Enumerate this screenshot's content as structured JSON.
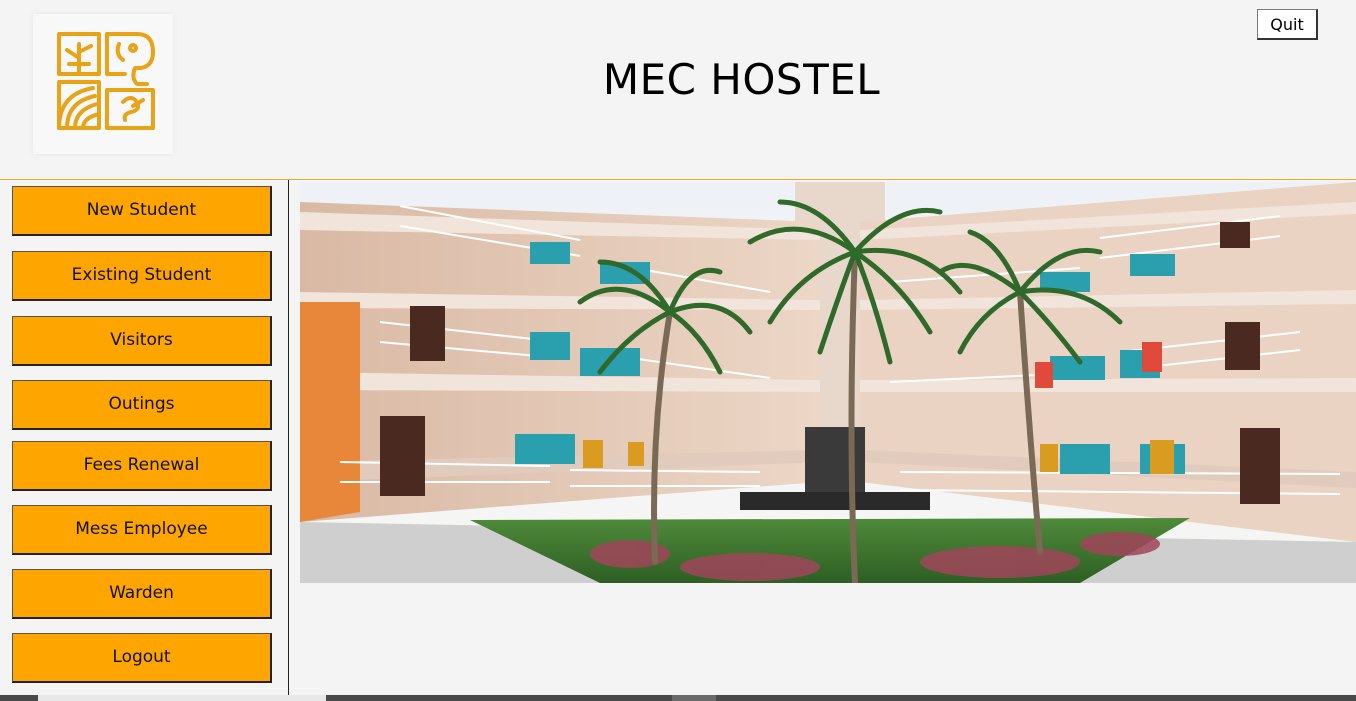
{
  "header": {
    "title": "MEC HOSTEL",
    "quit_label": "Quit",
    "logo_icon": "elephant-logo-icon",
    "accent_color": "#e8a317"
  },
  "sidebar": {
    "button_color": "#ffa500",
    "items": [
      {
        "label": "New Student"
      },
      {
        "label": "Existing Student"
      },
      {
        "label": "Visitors"
      },
      {
        "label": "Outings"
      },
      {
        "label": "Fees Renewal"
      },
      {
        "label": "Mess Employee"
      },
      {
        "label": "Warden"
      },
      {
        "label": "Logout"
      }
    ]
  },
  "main": {
    "hero_image": "hostel-courtyard-photo"
  }
}
